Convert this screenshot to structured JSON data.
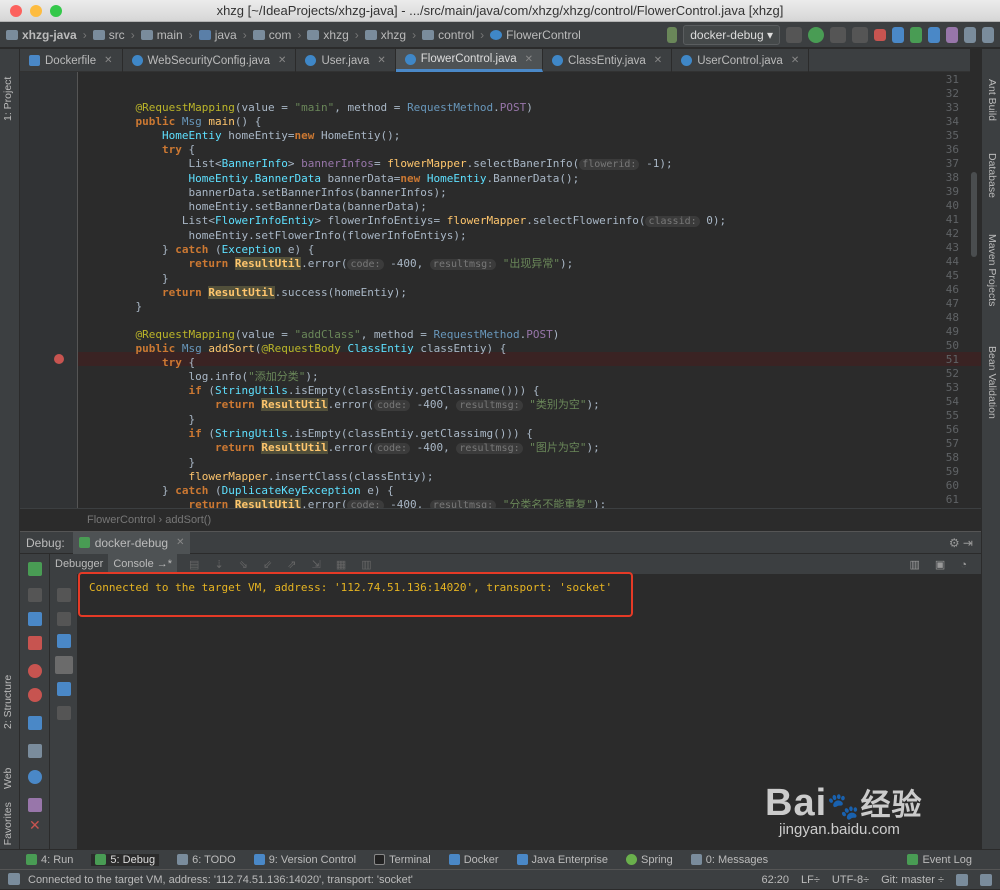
{
  "window": {
    "title": "xhzg [~/IdeaProjects/xhzg-java] - .../src/main/java/com/xhzg/xhzg/control/FlowerControl.java [xhzg]"
  },
  "breadcrumbs": [
    "xhzg-java",
    "src",
    "main",
    "java",
    "com",
    "xhzg",
    "xhzg",
    "control",
    "FlowerControl"
  ],
  "run_config": "docker-debug",
  "tabs": [
    "Dockerfile",
    "WebSecurityConfig.java",
    "User.java",
    "FlowerControl.java",
    "ClassEntiy.java",
    "UserControl.java"
  ],
  "active_tab": "FlowerControl.java",
  "left_panels": [
    "1: Project",
    "2: Structure",
    "Web",
    "2: Favorites"
  ],
  "right_panels": [
    "Ant Build",
    "Database",
    "Maven Projects",
    "Bean Validation"
  ],
  "line_numbers": [
    "31",
    "32",
    "33",
    "34",
    "35",
    "36",
    "37",
    "38",
    "39",
    "40",
    "41",
    "42",
    "43",
    "44",
    "45",
    "46",
    "47",
    "48",
    "49",
    "50",
    "51",
    "52",
    "53",
    "54",
    "55",
    "56",
    "57",
    "58",
    "59",
    "60",
    "61"
  ],
  "breakpoint_line": "51",
  "code_path": {
    "class": "FlowerControl",
    "method": "addSort()"
  },
  "debug": {
    "label": "Debug:",
    "config": "docker-debug",
    "tabs": [
      "Debugger",
      "Console"
    ],
    "active_tab": "Console",
    "console_output": "Connected to the target VM, address: '112.74.51.136:14020', transport: 'socket'"
  },
  "bottom_tools": [
    "4: Run",
    "5: Debug",
    "6: TODO",
    "9: Version Control",
    "Terminal",
    "Docker",
    "Java Enterprise",
    "Spring",
    "0: Messages",
    "Event Log"
  ],
  "status": {
    "message": "Connected to the target VM, address: '112.74.51.136:14020', transport: 'socket'",
    "position": "62:20",
    "line_sep": "LF÷",
    "encoding": "UTF-8÷",
    "git": "Git: master ÷"
  },
  "watermark": {
    "brand": "Bai",
    "brand2": "经验",
    "url": "jingyan.baidu.com"
  },
  "colors": {
    "accent": "#4a88c7",
    "highlight_box": "#e53a26",
    "console_text": "#e6b422",
    "breakpoint": "#c75450"
  }
}
